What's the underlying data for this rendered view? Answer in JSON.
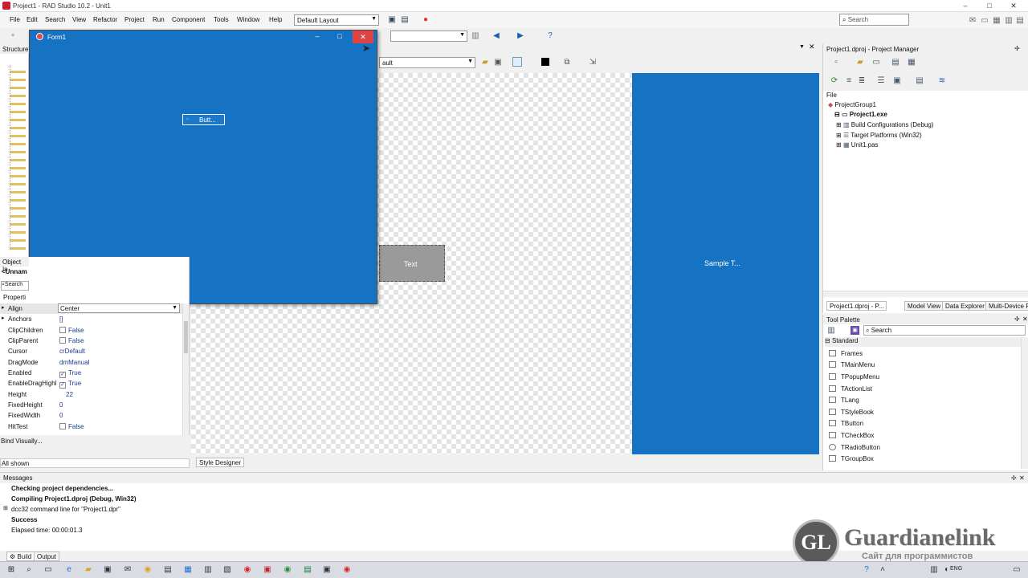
{
  "window": {
    "title": "Project1 - RAD Studio 10.2 - Unit1",
    "controls": {
      "minimize": "–",
      "maximize": "□",
      "close": "✕"
    }
  },
  "menu": [
    "File",
    "Edit",
    "Search",
    "View",
    "Refactor",
    "Project",
    "Run",
    "Component",
    "Tools",
    "Window",
    "Help"
  ],
  "layout_combo": "Default Layout",
  "search_placeholder": "Search",
  "structure": {
    "title": "Structure"
  },
  "form_window": {
    "title": "Form1",
    "button_label": "Butt...",
    "controls": {
      "minimize": "–",
      "maximize": "□",
      "close": "✕"
    }
  },
  "designer": {
    "style_combo": "ault",
    "text_shape": "Text",
    "sample_text": "Sample T...",
    "style_designer_tab": "Style Designer"
  },
  "object_inspector": {
    "title": "Object In",
    "object": "<Unnam",
    "search": "Search",
    "tab": "Properti",
    "properties": [
      {
        "name": "Align",
        "value": "Center"
      },
      {
        "name": "Anchors",
        "value": "[]"
      },
      {
        "name": "ClipChildren",
        "value": "False",
        "check": ""
      },
      {
        "name": "ClipParent",
        "value": "False",
        "check": ""
      },
      {
        "name": "Cursor",
        "value": "crDefault"
      },
      {
        "name": "DragMode",
        "value": "dmManual"
      },
      {
        "name": "Enabled",
        "value": "True",
        "check": "✓"
      },
      {
        "name": "EnableDragHighl",
        "value": "True",
        "check": "✓"
      },
      {
        "name": "Height",
        "value": "22"
      },
      {
        "name": "FixedHeight",
        "value": "0"
      },
      {
        "name": "FixedWidth",
        "value": "0"
      },
      {
        "name": "HitTest",
        "value": "False",
        "check": ""
      }
    ],
    "bind_visually": "Bind Visually...",
    "all_shown": "All shown"
  },
  "project_manager": {
    "title": "Project1.dproj - Project Manager",
    "file_label": "File",
    "tree": [
      "ProjectGroup1",
      "Project1.exe",
      "Build Configurations (Debug)",
      "Target Platforms (Win32)",
      "Unit1.pas"
    ],
    "tabs": [
      "Project1.dproj - P...",
      "Model View",
      "Data Explorer",
      "Multi-Device Prev..."
    ]
  },
  "tool_palette": {
    "title": "Tool Palette",
    "search": "Search",
    "category": "Standard",
    "items": [
      "Frames",
      "TMainMenu",
      "TPopupMenu",
      "TActionList",
      "TLang",
      "TStyleBook",
      "TButton",
      "TCheckBox",
      "TRadioButton",
      "TGroupBox"
    ]
  },
  "messages": {
    "title": "Messages",
    "lines": [
      "Checking project dependencies...",
      "Compiling Project1.dproj (Debug, Win32)",
      "dcc32 command line for \"Project1.dpr\"",
      "Success",
      "Elapsed time: 00:00:01.3"
    ],
    "tabs": [
      "Build",
      "Output"
    ]
  },
  "watermark": {
    "logo": "GL",
    "brand": "Guardianelink",
    "tagline": "Сайт для программистов"
  },
  "tray": {
    "lang": "ENG"
  },
  "colors": {
    "form_blue": "#1672c3",
    "close_red": "#e04343",
    "text_shape": "#9a9a9a"
  }
}
